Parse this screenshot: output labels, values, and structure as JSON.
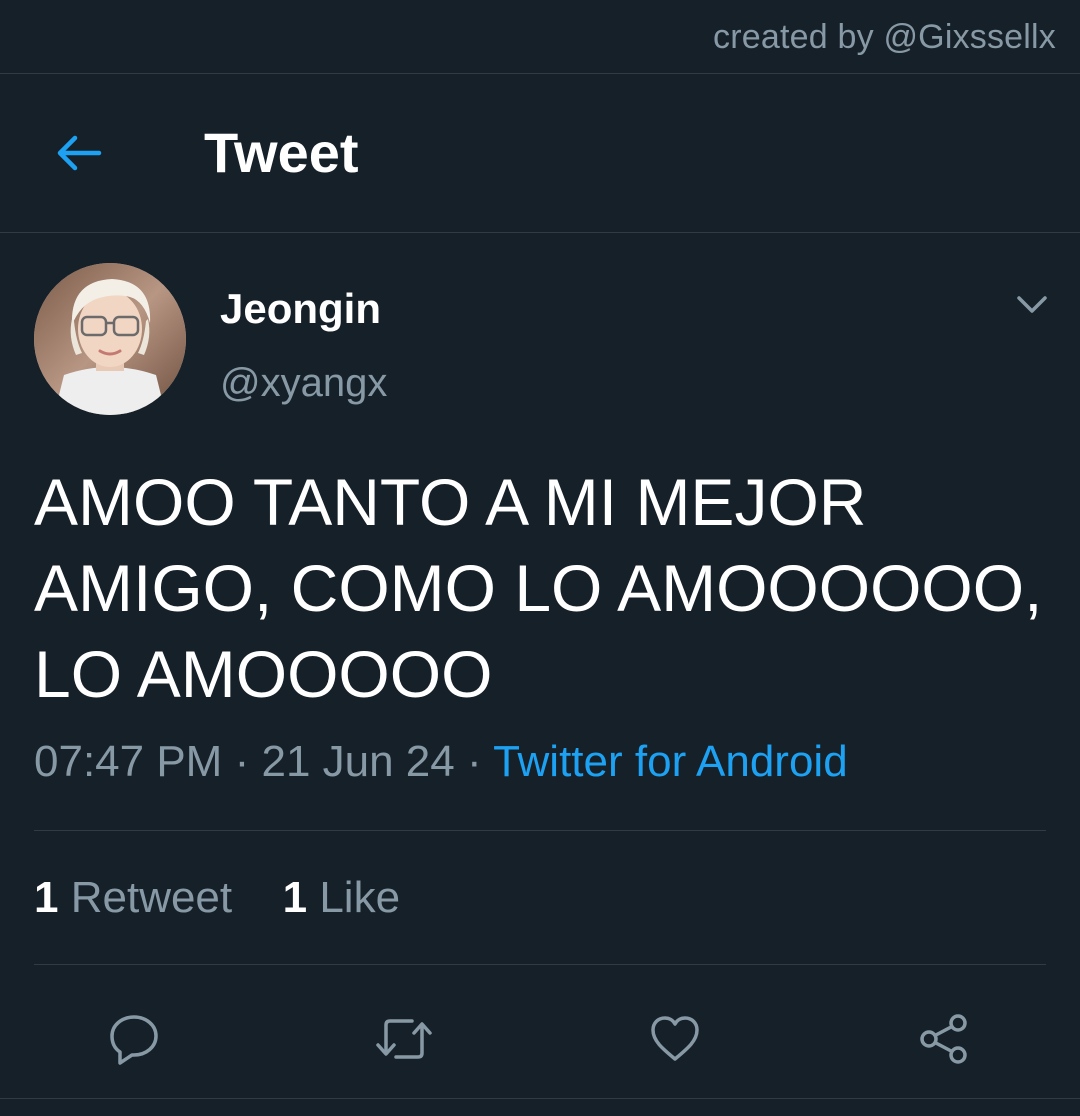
{
  "credit": "created by @Gixssellx",
  "header": {
    "title": "Tweet",
    "back_icon": "arrow-left-icon",
    "accent": "#1da1f2"
  },
  "tweet": {
    "display_name": "Jeongin",
    "handle": "@xyangx",
    "text": "AMOO TANTO A MI MEJOR AMIGO, COMO LO AMOOOOOO, LO AMOOOOO",
    "time": "07:47 PM",
    "separator": "·",
    "date": "21 Jun 24",
    "source": "Twitter for Android",
    "retweets": {
      "count": "1",
      "label": "Retweet"
    },
    "likes": {
      "count": "1",
      "label": "Like"
    }
  },
  "actions": {
    "reply": "reply-icon",
    "retweet": "retweet-icon",
    "like": "heart-icon",
    "share": "share-icon"
  },
  "colors": {
    "background": "#162029",
    "text": "#ffffff",
    "secondary": "#8899a6",
    "link": "#1da1f2",
    "border": "#2f3b47"
  }
}
